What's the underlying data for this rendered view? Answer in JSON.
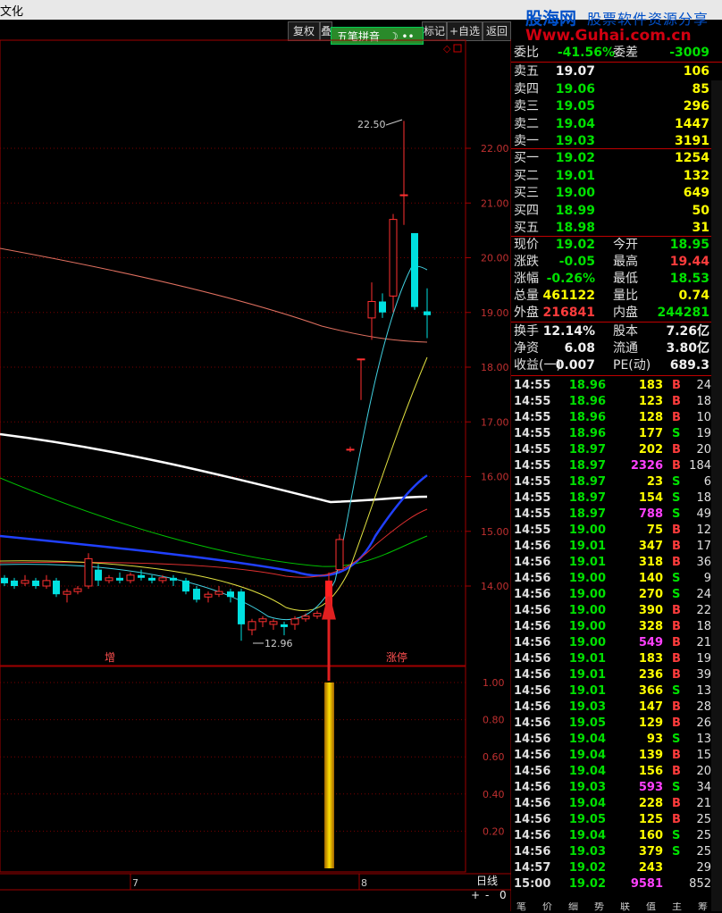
{
  "window": {
    "title": "文化"
  },
  "toolbar": {
    "buttons": [
      "复权",
      "叠",
      "叠加",
      "标记",
      "+自选",
      "返回"
    ],
    "ime_label": "五笔拼音"
  },
  "watermark": {
    "brand": "股海网",
    "slogan": "股票软件资源分享",
    "url": "Www.Guhai.com.cn"
  },
  "chart": {
    "price_axis": [
      "22.00",
      "21.00",
      "20.00",
      "19.00",
      "18.00",
      "17.00",
      "16.00",
      "15.00",
      "14.00"
    ],
    "indicator_axis": [
      "1.00",
      "0.80",
      "0.60",
      "0.40",
      "0.20"
    ],
    "high_label": "22.50",
    "low_label": "12.96",
    "event_labels": [
      "增",
      "涨停"
    ],
    "x_labels": [
      "7",
      "8"
    ],
    "period": "日线",
    "zoom_controls": [
      "+",
      "-",
      "0"
    ]
  },
  "order_book": {
    "ratio_label": "委比",
    "ratio_value": "-41.56%",
    "diff_label": "委差",
    "diff_value": "-3009",
    "asks": [
      {
        "label": "卖五",
        "price": "19.07",
        "vol": "106"
      },
      {
        "label": "卖四",
        "price": "19.06",
        "vol": "85"
      },
      {
        "label": "卖三",
        "price": "19.05",
        "vol": "296"
      },
      {
        "label": "卖二",
        "price": "19.04",
        "vol": "1447"
      },
      {
        "label": "卖一",
        "price": "19.03",
        "vol": "3191"
      }
    ],
    "bids": [
      {
        "label": "买一",
        "price": "19.02",
        "vol": "1254"
      },
      {
        "label": "买二",
        "price": "19.01",
        "vol": "132"
      },
      {
        "label": "买三",
        "price": "19.00",
        "vol": "649"
      },
      {
        "label": "买四",
        "price": "18.99",
        "vol": "50"
      },
      {
        "label": "买五",
        "price": "18.98",
        "vol": "31"
      }
    ]
  },
  "quote": [
    {
      "l1": "现价",
      "v1": "19.02",
      "c1": "green",
      "l2": "今开",
      "v2": "18.95",
      "c2": "green"
    },
    {
      "l1": "涨跌",
      "v1": "-0.05",
      "c1": "green",
      "l2": "最高",
      "v2": "19.44",
      "c2": "red"
    },
    {
      "l1": "涨幅",
      "v1": "-0.26%",
      "c1": "green",
      "l2": "最低",
      "v2": "18.53",
      "c2": "green"
    },
    {
      "l1": "总量",
      "v1": "461122",
      "c1": "yellow",
      "l2": "量比",
      "v2": "0.74",
      "c2": "yellow"
    },
    {
      "l1": "外盘",
      "v1": "216841",
      "c1": "red",
      "l2": "内盘",
      "v2": "244281",
      "c2": "green"
    }
  ],
  "fundamentals": [
    {
      "l1": "换手",
      "v1": "12.14%",
      "l2": "股本",
      "v2": "7.26亿"
    },
    {
      "l1": "净资",
      "v1": "6.08",
      "l2": "流通",
      "v2": "3.80亿"
    },
    {
      "l1": "收益(一)",
      "v1": "0.007",
      "l2": "PE(动)",
      "v2": "689.3"
    }
  ],
  "ticks": [
    {
      "t": "14:55",
      "p": "18.96",
      "pc": "green",
      "v": "183",
      "vc": "yellow",
      "bs": "B",
      "n": "24"
    },
    {
      "t": "14:55",
      "p": "18.96",
      "pc": "green",
      "v": "123",
      "vc": "yellow",
      "bs": "B",
      "n": "18"
    },
    {
      "t": "14:55",
      "p": "18.96",
      "pc": "green",
      "v": "128",
      "vc": "yellow",
      "bs": "B",
      "n": "10"
    },
    {
      "t": "14:55",
      "p": "18.96",
      "pc": "green",
      "v": "177",
      "vc": "yellow",
      "bs": "S",
      "n": "19"
    },
    {
      "t": "14:55",
      "p": "18.97",
      "pc": "green",
      "v": "202",
      "vc": "yellow",
      "bs": "B",
      "n": "20"
    },
    {
      "t": "14:55",
      "p": "18.97",
      "pc": "green",
      "v": "2326",
      "vc": "purple",
      "bs": "B",
      "n": "184"
    },
    {
      "t": "14:55",
      "p": "18.97",
      "pc": "green",
      "v": "23",
      "vc": "yellow",
      "bs": "S",
      "n": "6"
    },
    {
      "t": "14:55",
      "p": "18.97",
      "pc": "green",
      "v": "154",
      "vc": "yellow",
      "bs": "S",
      "n": "18"
    },
    {
      "t": "14:55",
      "p": "18.97",
      "pc": "green",
      "v": "788",
      "vc": "purple",
      "bs": "S",
      "n": "49"
    },
    {
      "t": "14:55",
      "p": "19.00",
      "pc": "green",
      "v": "75",
      "vc": "yellow",
      "bs": "B",
      "n": "12"
    },
    {
      "t": "14:56",
      "p": "19.01",
      "pc": "green",
      "v": "347",
      "vc": "yellow",
      "bs": "B",
      "n": "17"
    },
    {
      "t": "14:56",
      "p": "19.01",
      "pc": "green",
      "v": "318",
      "vc": "yellow",
      "bs": "B",
      "n": "36"
    },
    {
      "t": "14:56",
      "p": "19.00",
      "pc": "green",
      "v": "140",
      "vc": "yellow",
      "bs": "S",
      "n": "9"
    },
    {
      "t": "14:56",
      "p": "19.00",
      "pc": "green",
      "v": "270",
      "vc": "yellow",
      "bs": "S",
      "n": "24"
    },
    {
      "t": "14:56",
      "p": "19.00",
      "pc": "green",
      "v": "390",
      "vc": "yellow",
      "bs": "B",
      "n": "22"
    },
    {
      "t": "14:56",
      "p": "19.00",
      "pc": "green",
      "v": "328",
      "vc": "yellow",
      "bs": "B",
      "n": "18"
    },
    {
      "t": "14:56",
      "p": "19.00",
      "pc": "green",
      "v": "549",
      "vc": "purple",
      "bs": "B",
      "n": "21"
    },
    {
      "t": "14:56",
      "p": "19.01",
      "pc": "green",
      "v": "183",
      "vc": "yellow",
      "bs": "B",
      "n": "19"
    },
    {
      "t": "14:56",
      "p": "19.01",
      "pc": "green",
      "v": "236",
      "vc": "yellow",
      "bs": "B",
      "n": "39"
    },
    {
      "t": "14:56",
      "p": "19.01",
      "pc": "green",
      "v": "366",
      "vc": "yellow",
      "bs": "S",
      "n": "13"
    },
    {
      "t": "14:56",
      "p": "19.03",
      "pc": "green",
      "v": "147",
      "vc": "yellow",
      "bs": "B",
      "n": "28"
    },
    {
      "t": "14:56",
      "p": "19.05",
      "pc": "green",
      "v": "129",
      "vc": "yellow",
      "bs": "B",
      "n": "26"
    },
    {
      "t": "14:56",
      "p": "19.04",
      "pc": "green",
      "v": "93",
      "vc": "yellow",
      "bs": "S",
      "n": "13"
    },
    {
      "t": "14:56",
      "p": "19.04",
      "pc": "green",
      "v": "139",
      "vc": "yellow",
      "bs": "B",
      "n": "15"
    },
    {
      "t": "14:56",
      "p": "19.04",
      "pc": "green",
      "v": "156",
      "vc": "yellow",
      "bs": "B",
      "n": "20"
    },
    {
      "t": "14:56",
      "p": "19.03",
      "pc": "green",
      "v": "593",
      "vc": "purple",
      "bs": "S",
      "n": "34"
    },
    {
      "t": "14:56",
      "p": "19.04",
      "pc": "green",
      "v": "228",
      "vc": "yellow",
      "bs": "B",
      "n": "21"
    },
    {
      "t": "14:56",
      "p": "19.05",
      "pc": "green",
      "v": "125",
      "vc": "yellow",
      "bs": "B",
      "n": "25"
    },
    {
      "t": "14:56",
      "p": "19.04",
      "pc": "green",
      "v": "160",
      "vc": "yellow",
      "bs": "S",
      "n": "25"
    },
    {
      "t": "14:56",
      "p": "19.03",
      "pc": "green",
      "v": "379",
      "vc": "yellow",
      "bs": "S",
      "n": "25"
    },
    {
      "t": "14:57",
      "p": "19.02",
      "pc": "green",
      "v": "243",
      "vc": "yellow",
      "bs": "",
      "n": "29"
    },
    {
      "t": "15:00",
      "p": "19.02",
      "pc": "green",
      "v": "9581",
      "vc": "purple",
      "bs": "",
      "n": "852"
    }
  ],
  "bottom_tabs": [
    "笔",
    "价",
    "细",
    "势",
    "联",
    "值",
    "主",
    "筹"
  ]
}
